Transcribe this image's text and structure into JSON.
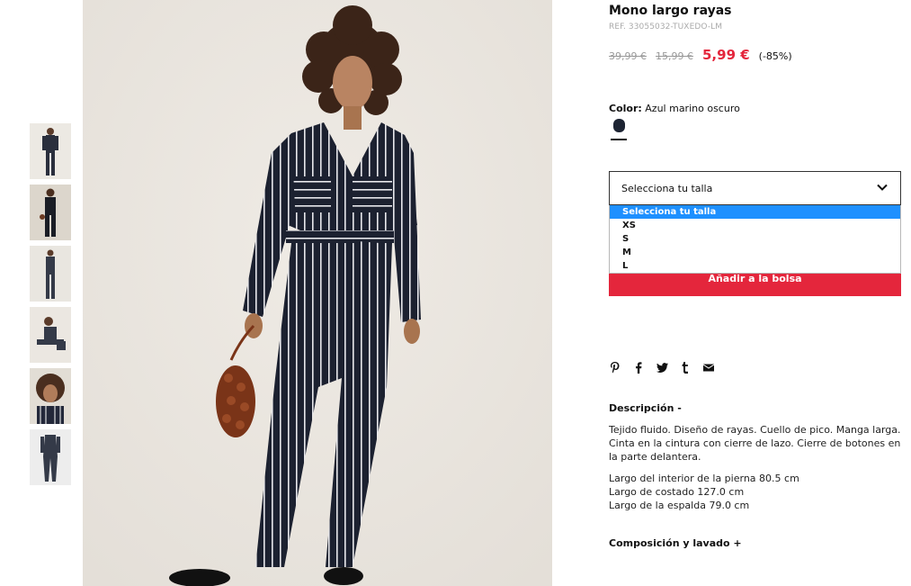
{
  "product": {
    "title": "Mono largo rayas",
    "ref": "REF. 33055032-TUXEDO-LM",
    "old_prices": [
      "39,99 €",
      "15,99 €"
    ],
    "current_price": "5,99 €",
    "discount": "(-85%)"
  },
  "color": {
    "label": "Color:",
    "value": "Azul marino oscuro",
    "swatch_color": "#1d2433"
  },
  "size_select": {
    "label": "Selecciona tu talla",
    "icon": "chevron-down-icon",
    "options": [
      "Selecciona tu talla",
      "XS",
      "S",
      "M",
      "L"
    ],
    "selected_index": 0
  },
  "add_to_bag": "Añadir a la bolsa",
  "social_icons": [
    "pinterest-icon",
    "facebook-icon",
    "twitter-icon",
    "tumblr-icon",
    "email-icon"
  ],
  "description": {
    "title": "Descripción -",
    "text": "Tejido fluido. Diseño de rayas. Cuello de pico. Manga larga. Cinta en la cintura con cierre de lazo. Cierre de botones en la parte delantera.",
    "measures": [
      "Largo del interior de la pierna 80.5 cm",
      "Largo de costado 127.0 cm",
      "Largo de la espalda 79.0 cm"
    ]
  },
  "composition": {
    "title": "Composición y lavado +"
  },
  "colors": {
    "accent": "#e4263c",
    "dropdown_highlight": "#1e90ff",
    "background_photo": "#ebe7e1"
  }
}
